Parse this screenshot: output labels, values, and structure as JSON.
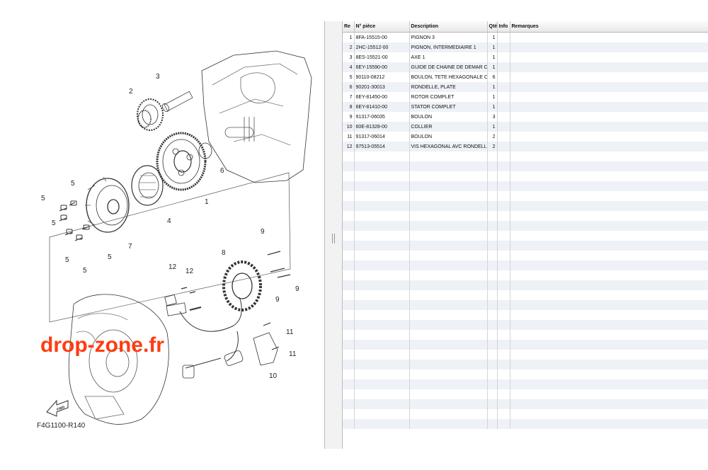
{
  "diagram": {
    "callouts": [
      "1",
      "2",
      "3",
      "4",
      "5",
      "5",
      "5",
      "5",
      "5",
      "5",
      "6",
      "7",
      "8",
      "9",
      "9",
      "9",
      "10",
      "11",
      "11",
      "12",
      "12"
    ],
    "watermark": "drop-zone.fr",
    "fwd_label": "FWD",
    "figure_code": "F4G1100-R140",
    "brand_color": "#ff3b12"
  },
  "table": {
    "columns": {
      "ref": "Re",
      "part_no": "N° pièce",
      "description": "Description",
      "qty": "Qté",
      "info": "Info",
      "remarks": "Remarques"
    },
    "rows": [
      {
        "ref": "1",
        "part_no": "8FA-15515-00",
        "description": "PIGNON 3",
        "qty": "1"
      },
      {
        "ref": "2",
        "part_no": "2HC-15512-00",
        "description": "PIGNON, INTERMEDIAIRE 1",
        "qty": "1"
      },
      {
        "ref": "3",
        "part_no": "8ES-15521-00",
        "description": "AXE 1",
        "qty": "1"
      },
      {
        "ref": "4",
        "part_no": "6EY-15590-00",
        "description": "GUIDE DE CHAINE DE DEMAR C",
        "qty": "1"
      },
      {
        "ref": "5",
        "part_no": "90110-08212",
        "description": "BOULON, TETE HEXAGONALE C",
        "qty": "6"
      },
      {
        "ref": "6",
        "part_no": "90201-30013",
        "description": "RONDELLE, PLATE",
        "qty": "1"
      },
      {
        "ref": "7",
        "part_no": "6EY-81450-00",
        "description": "ROTOR COMPLET",
        "qty": "1"
      },
      {
        "ref": "8",
        "part_no": "6EY-81410-00",
        "description": "STATOR COMPLET",
        "qty": "1"
      },
      {
        "ref": "9",
        "part_no": "91317-06035",
        "description": "BOULON",
        "qty": "3"
      },
      {
        "ref": "10",
        "part_no": "60E-81328-00",
        "description": "COLLIER",
        "qty": "1"
      },
      {
        "ref": "11",
        "part_no": "91317-06014",
        "description": "BOULON",
        "qty": "2"
      },
      {
        "ref": "12",
        "part_no": "97513-05514",
        "description": "VIS HEXAGONAL AVC RONDELL",
        "qty": "2"
      }
    ]
  }
}
